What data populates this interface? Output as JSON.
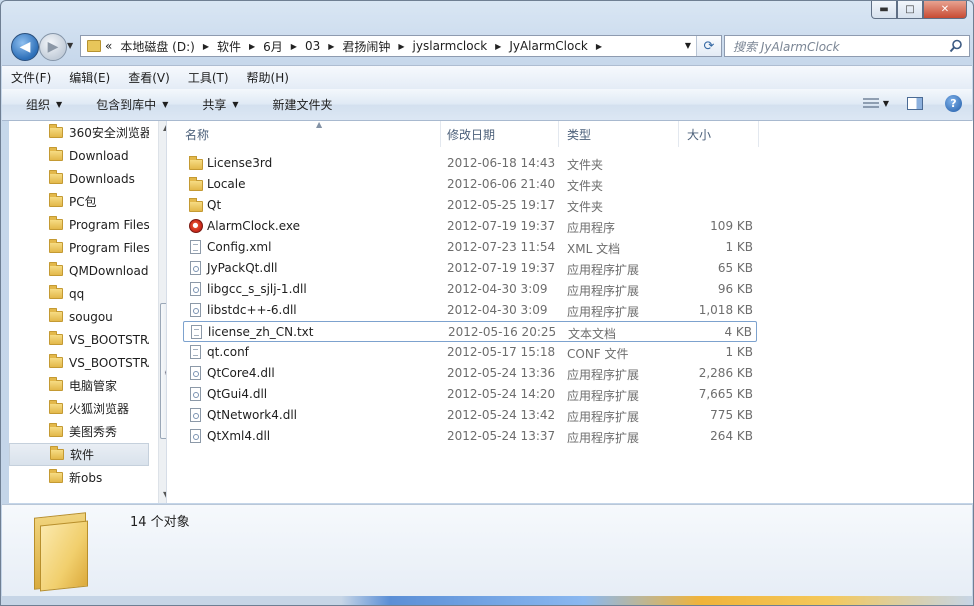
{
  "window": {
    "controls": {
      "min": "▬",
      "max": "□",
      "close": "✕"
    }
  },
  "nav": {
    "back_glyph": "◀",
    "forward_glyph": "▶",
    "breadcrumb": [
      "本地磁盘 (D:)",
      "软件",
      "6月",
      "03",
      "君扬闹钟",
      "jyslarmclock",
      "JyAlarmClock"
    ],
    "overflow": "«",
    "search_placeholder": "搜索 JyAlarmClock"
  },
  "menu": [
    "文件(F)",
    "编辑(E)",
    "查看(V)",
    "工具(T)",
    "帮助(H)"
  ],
  "toolbar": {
    "organize": "组织",
    "include_library": "包含到库中",
    "share": "共享",
    "new_folder": "新建文件夹"
  },
  "navpane": {
    "items": [
      {
        "label": "360安全浏览器"
      },
      {
        "label": "Download"
      },
      {
        "label": "Downloads"
      },
      {
        "label": "PC包"
      },
      {
        "label": "Program Files"
      },
      {
        "label": "Program Files"
      },
      {
        "label": "QMDownload"
      },
      {
        "label": "qq"
      },
      {
        "label": "sougou"
      },
      {
        "label": "VS_BOOTSTRA"
      },
      {
        "label": "VS_BOOTSTRA"
      },
      {
        "label": "电脑管家"
      },
      {
        "label": "火狐浏览器"
      },
      {
        "label": "美图秀秀"
      },
      {
        "label": "软件",
        "selected": true
      },
      {
        "label": "新obs"
      }
    ]
  },
  "columns": {
    "name": "名称",
    "date": "修改日期",
    "type": "类型",
    "size": "大小"
  },
  "files": [
    {
      "name": "License3rd",
      "date": "2012-06-18 14:43",
      "type": "文件夹",
      "size": "",
      "icon": "folder-icon"
    },
    {
      "name": "Locale",
      "date": "2012-06-06 21:40",
      "type": "文件夹",
      "size": "",
      "icon": "folder-icon"
    },
    {
      "name": "Qt",
      "date": "2012-05-25 19:17",
      "type": "文件夹",
      "size": "",
      "icon": "folder-icon"
    },
    {
      "name": "AlarmClock.exe",
      "date": "2012-07-19 19:37",
      "type": "应用程序",
      "size": "109 KB",
      "icon": "app-icon"
    },
    {
      "name": "Config.xml",
      "date": "2012-07-23 11:54",
      "type": "XML 文档",
      "size": "1 KB",
      "icon": "xml-file-icon"
    },
    {
      "name": "JyPackQt.dll",
      "date": "2012-07-19 19:37",
      "type": "应用程序扩展",
      "size": "65 KB",
      "icon": "dll-file-icon"
    },
    {
      "name": "libgcc_s_sjlj-1.dll",
      "date": "2012-04-30 3:09",
      "type": "应用程序扩展",
      "size": "96 KB",
      "icon": "dll-file-icon"
    },
    {
      "name": "libstdc++-6.dll",
      "date": "2012-04-30 3:09",
      "type": "应用程序扩展",
      "size": "1,018 KB",
      "icon": "dll-file-icon"
    },
    {
      "name": "license_zh_CN.txt",
      "date": "2012-05-16 20:25",
      "type": "文本文档",
      "size": "4 KB",
      "icon": "text-file-icon",
      "selected": true
    },
    {
      "name": "qt.conf",
      "date": "2012-05-17 15:18",
      "type": "CONF 文件",
      "size": "1 KB",
      "icon": "file-icon"
    },
    {
      "name": "QtCore4.dll",
      "date": "2012-05-24 13:36",
      "type": "应用程序扩展",
      "size": "2,286 KB",
      "icon": "dll-file-icon"
    },
    {
      "name": "QtGui4.dll",
      "date": "2012-05-24 14:20",
      "type": "应用程序扩展",
      "size": "7,665 KB",
      "icon": "dll-file-icon"
    },
    {
      "name": "QtNetwork4.dll",
      "date": "2012-05-24 13:42",
      "type": "应用程序扩展",
      "size": "775 KB",
      "icon": "dll-file-icon"
    },
    {
      "name": "QtXml4.dll",
      "date": "2012-05-24 13:37",
      "type": "应用程序扩展",
      "size": "264 KB",
      "icon": "dll-file-icon"
    }
  ],
  "details": {
    "count": "14 个对象"
  }
}
